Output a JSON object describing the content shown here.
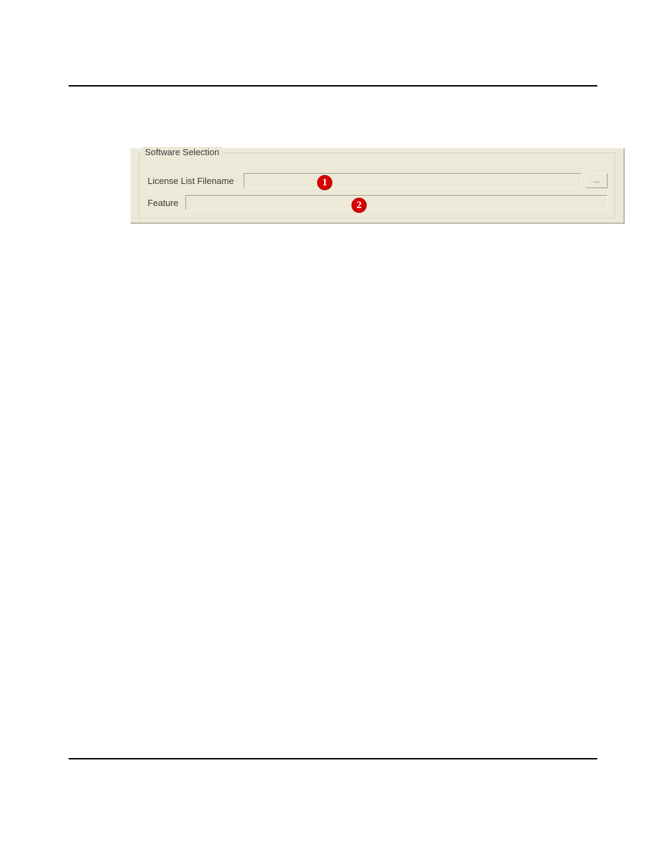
{
  "panel": {
    "group_label": "Software Selection",
    "license_label": "License List Filename",
    "feature_label": "Feature",
    "license_value": "",
    "feature_value": "",
    "browse_label": "..."
  },
  "callouts": {
    "one": "1",
    "two": "2"
  }
}
